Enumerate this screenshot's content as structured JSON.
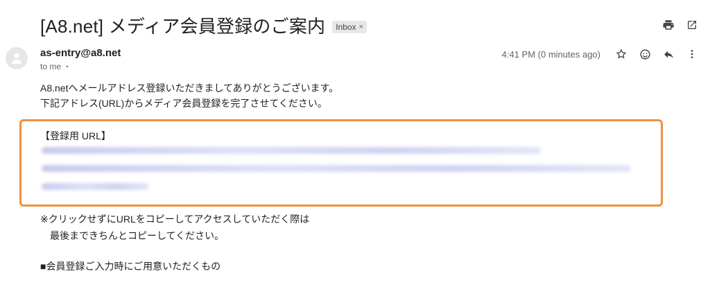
{
  "email": {
    "subject": "[A8.net] メディア会員登録のご案内",
    "label_chip": "Inbox",
    "label_chip_close": "×",
    "sender": "as-entry@a8.net",
    "to": "to me",
    "timestamp": "4:41 PM (0 minutes ago)",
    "body": {
      "line1": "A8.netへメールアドレス登録いただきましてありがとうございます。",
      "line2": "下記アドレス(URL)からメディア会員登録を完了させてください。",
      "registration_label": "【登録用 URL】",
      "note_line1": "※クリックせずにURLをコピーしてアクセスしていただく際は",
      "note_line2": "最後まできちんとコピーしてください。",
      "section_heading": "■会員登録ご入力時にご用意いただくもの"
    }
  },
  "colors": {
    "highlight_border": "#f0903a",
    "link_blur": "#c7cbee"
  },
  "icons": [
    "print-icon",
    "open-in-new-window-icon",
    "star-icon",
    "emoji-icon",
    "reply-icon",
    "more-vert-icon",
    "avatar-person-icon",
    "chevron-down-icon"
  ]
}
